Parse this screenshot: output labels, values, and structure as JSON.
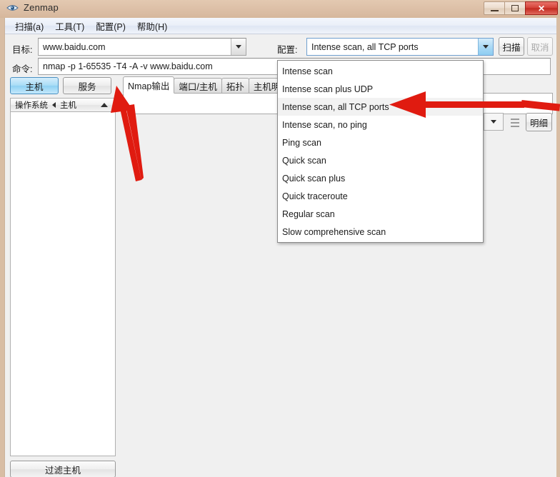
{
  "window": {
    "title": "Zenmap",
    "icon": "eye-icon",
    "controls": {
      "minimize": "–",
      "maximize": "□",
      "close": "✕"
    }
  },
  "menubar": {
    "items": [
      {
        "label": "扫描(a)",
        "text": "扫描",
        "mnemonic": "a"
      },
      {
        "label": "工具(T)",
        "text": "工具",
        "mnemonic": "T"
      },
      {
        "label": "配置(P)",
        "text": "配置",
        "mnemonic": "P"
      },
      {
        "label": "帮助(H)",
        "text": "帮助",
        "mnemonic": "H"
      }
    ]
  },
  "toolbar": {
    "target_label": "目标:",
    "target_value": "www.baidu.com",
    "profile_label": "配置:",
    "profile_value": "Intense scan, all TCP ports",
    "command_label": "命令:",
    "command_value": "nmap -p 1-65535 -T4 -A -v www.baidu.com",
    "scan_button": "扫描",
    "cancel_button": "取消"
  },
  "profile_dropdown": {
    "open": true,
    "selected_index": 2,
    "items": [
      "Intense scan",
      "Intense scan plus UDP",
      "Intense scan, all TCP ports",
      "Intense scan, no ping",
      "Ping scan",
      "Quick scan",
      "Quick scan plus",
      "Quick traceroute",
      "Regular scan",
      "Slow comprehensive scan"
    ]
  },
  "left_pane": {
    "segmented": [
      {
        "label": "主机",
        "active": true
      },
      {
        "label": "服务",
        "active": false
      }
    ],
    "column_header": {
      "os": "操作系统",
      "host": "主机",
      "sort": "ascending"
    },
    "host_rows": [],
    "filter_button": "过滤主机"
  },
  "right_pane": {
    "tabs": [
      {
        "label": "Nmap输出",
        "active": true
      },
      {
        "label": "端口/主机",
        "active": false
      },
      {
        "label": "拓扑",
        "active": false
      },
      {
        "label": "主机明细",
        "active": false
      }
    ],
    "detail_button": "明细",
    "output_text": ""
  },
  "annotations": {
    "arrow_color": "#e01b10",
    "arrows": [
      {
        "name": "arrow-to-hosts-tab",
        "direction": "up-left"
      },
      {
        "name": "arrow-to-selected-profile",
        "direction": "left"
      }
    ]
  },
  "colors": {
    "titlebar": "#dcbfa6",
    "menubar": "#eaeff8",
    "client": "#f0f0f0",
    "accent_blue": "#a9dcf6",
    "close_red": "#d6453b",
    "annotation_red": "#e01b10"
  }
}
